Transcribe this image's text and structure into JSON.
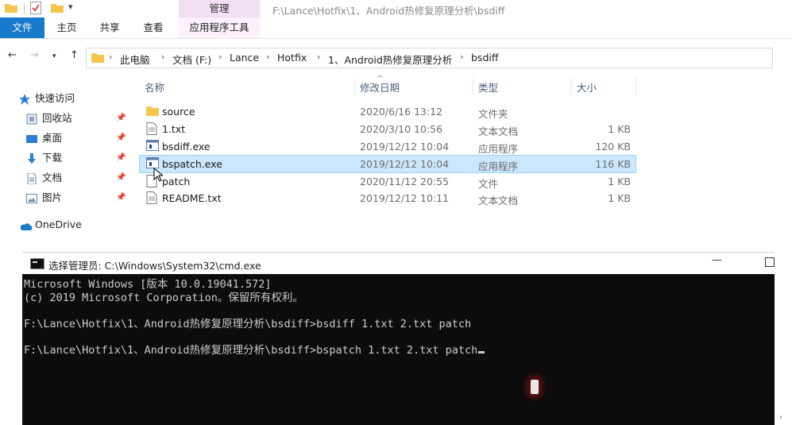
{
  "ribbon": {
    "context_tab": "管理",
    "title_path": "F:\\Lance\\Hotfix\\1、Android热修复原理分析\\bsdiff",
    "tabs": {
      "file": "文件",
      "home": "主页",
      "share": "共享",
      "view": "查看",
      "app_tools": "应用程序工具"
    }
  },
  "address": {
    "crumbs": [
      "此电脑",
      "文档 (F:)",
      "Lance",
      "Hotfix",
      "1、Android热修复原理分析",
      "bsdiff"
    ]
  },
  "nav_pane": {
    "quick_access": "快速访问",
    "items": [
      "回收站",
      "桌面",
      "下载",
      "文档",
      "图片"
    ],
    "onedrive": "OneDrive"
  },
  "columns": {
    "name": "名称",
    "date": "修改日期",
    "type": "类型",
    "size": "大小"
  },
  "files": [
    {
      "name": "source",
      "date": "2020/6/16 13:12",
      "type": "文件夹",
      "size": ""
    },
    {
      "name": "1.txt",
      "date": "2020/3/10 10:56",
      "type": "文本文档",
      "size": "1 KB"
    },
    {
      "name": "bsdiff.exe",
      "date": "2019/12/12 10:04",
      "type": "应用程序",
      "size": "120 KB"
    },
    {
      "name": "bspatch.exe",
      "date": "2019/12/12 10:04",
      "type": "应用程序",
      "size": "116 KB"
    },
    {
      "name": "patch",
      "date": "2020/11/12 20:55",
      "type": "文件",
      "size": "1 KB"
    },
    {
      "name": "README.txt",
      "date": "2019/12/12 10:11",
      "type": "文本文档",
      "size": "1 KB"
    }
  ],
  "cmd": {
    "title": "选择管理员: C:\\Windows\\System32\\cmd.exe",
    "lines": [
      "Microsoft Windows [版本 10.0.19041.572]",
      "(c) 2019 Microsoft Corporation。保留所有权利。",
      "F:\\Lance\\Hotfix\\1、Android热修复原理分析\\bsdiff>bsdiff 1.txt 2.txt patch",
      "F:\\Lance\\Hotfix\\1、Android热修复原理分析\\bsdiff>bspatch 1.txt 2.txt patch"
    ]
  },
  "colors": {
    "file_tab": "#1979ca",
    "context_tab": "#f3dff3",
    "selection": "#cce8ff",
    "console_bg": "#0c0c0c"
  }
}
